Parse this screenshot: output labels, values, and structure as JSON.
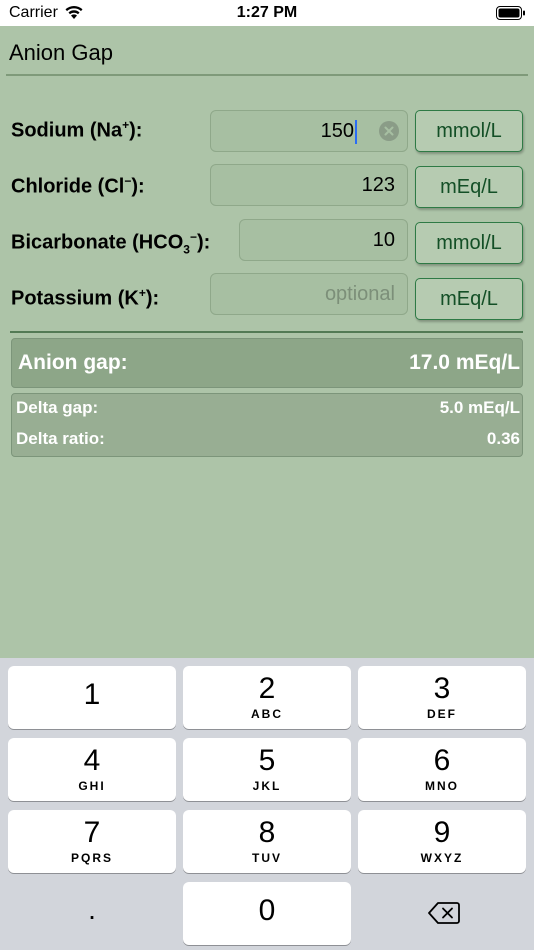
{
  "status": {
    "carrier": "Carrier",
    "time": "1:27 PM"
  },
  "title": "Anion Gap",
  "rows": [
    {
      "label": "Sodium (Na",
      "sup": "+",
      "tail": "):",
      "value": "150",
      "placeholder": "",
      "unit": "mmol/L"
    },
    {
      "label": "Chloride (Cl",
      "sup": "−",
      "tail": "):",
      "value": "123",
      "placeholder": "",
      "unit": "mEq/L"
    },
    {
      "label": "Bicarbonate (HCO",
      "sub": "3",
      "sup": "−",
      "tail": "):",
      "value": "10",
      "placeholder": "",
      "unit": "mmol/L"
    },
    {
      "label": "Potassium (K",
      "sup": "+",
      "tail": "):",
      "value": "",
      "placeholder": "optional",
      "unit": "mEq/L"
    }
  ],
  "results": {
    "anion_gap_label": "Anion gap:",
    "anion_gap_value": "17.0 mEq/L",
    "delta_gap_label": "Delta gap:",
    "delta_gap_value": "5.0 mEq/L",
    "delta_ratio_label": "Delta ratio:",
    "delta_ratio_value": "0.36"
  },
  "keypad": {
    "keys": [
      {
        "num": "1",
        "letters": ""
      },
      {
        "num": "2",
        "letters": "ABC"
      },
      {
        "num": "3",
        "letters": "DEF"
      },
      {
        "num": "4",
        "letters": "GHI"
      },
      {
        "num": "5",
        "letters": "JKL"
      },
      {
        "num": "6",
        "letters": "MNO"
      },
      {
        "num": "7",
        "letters": "PQRS"
      },
      {
        "num": "8",
        "letters": "TUV"
      },
      {
        "num": "9",
        "letters": "WXYZ"
      },
      {
        "num": "0",
        "letters": ""
      }
    ],
    "dot": "."
  }
}
